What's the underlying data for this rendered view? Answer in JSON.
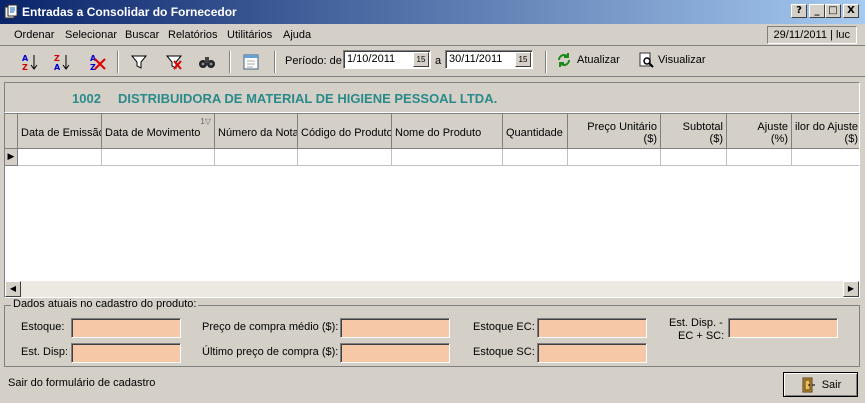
{
  "window": {
    "title": "Entradas a Consolidar do Fornecedor",
    "buttons": [
      "?",
      "_",
      "□",
      "X"
    ]
  },
  "menu": {
    "items": [
      "Ordenar",
      "Selecionar",
      "Buscar",
      "Relatórios",
      "Utilitários",
      "Ajuda"
    ],
    "date_user": "29/11/2011 | luc"
  },
  "toolbar": {
    "icons": [
      "sort-ascending-icon",
      "sort-descending-icon",
      "clear-sort-icon",
      "filter-icon",
      "clear-filter-icon",
      "binoculars-icon",
      "form-icon"
    ],
    "periodo_label": "Período: de",
    "periodo_from": "1/10/2011",
    "periodo_sep": "a",
    "periodo_to": "30/11/2011",
    "calendar_glyph": "15",
    "atualizar_label": "Atualizar",
    "visualizar_label": "Visualizar"
  },
  "supplier": {
    "code": "1002",
    "name": "DISTRIBUIDORA DE MATERIAL DE HIGIENE PESSOAL LTDA."
  },
  "grid": {
    "columns": [
      {
        "label": "Data de Emissão"
      },
      {
        "label": "Data de Movimento"
      },
      {
        "label": "Número da Nota"
      },
      {
        "label": "Código do Produto"
      },
      {
        "label": "Nome do Produto"
      },
      {
        "label": "Quantidade"
      },
      {
        "label": "Preço Unitário\n($)"
      },
      {
        "label": "Subtotal\n($)"
      },
      {
        "label": "Ajuste\n(%)"
      },
      {
        "label": "ilor do Ajuste\n($)"
      }
    ],
    "row_indicator": "▶",
    "scroll_left": "◀",
    "scroll_right": "▶"
  },
  "product": {
    "group_label": "Dados atuais no cadastro do produto:",
    "estoque_label": "Estoque:",
    "est_disp_label": "Est. Disp:",
    "preco_medio_label": "Preço de compra médio ($):",
    "ultimo_preco_label": "Último preço de compra ($):",
    "estoque_ec_label": "Estoque EC:",
    "estoque_sc_label": "Estoque SC:",
    "est_disp_ec_sc_label_1": "Est. Disp. -",
    "est_disp_ec_sc_label_2": "EC + SC:",
    "field_color": "#f6c8a8"
  },
  "status": {
    "text": "Sair do formulário de cadastro",
    "sair_label": "Sair"
  },
  "colors": {
    "titlebar": "#0a246a",
    "supplier_text": "#2a8a8a",
    "window_bg": "#d4d0c8"
  }
}
